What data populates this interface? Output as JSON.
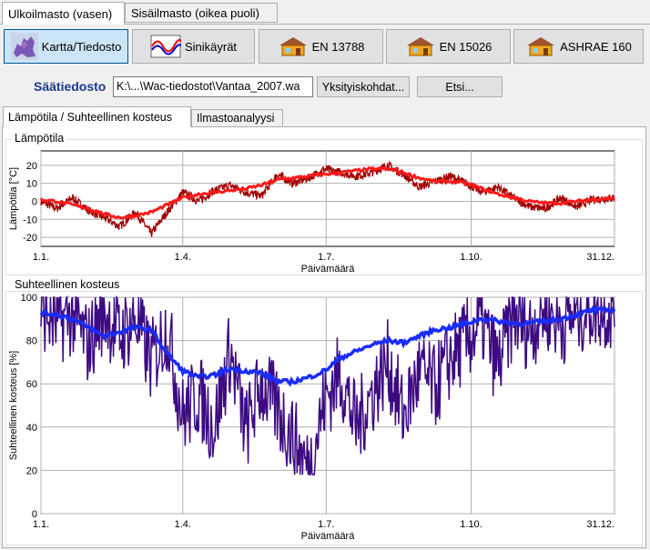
{
  "top_tabs": [
    {
      "label": "Ulkoilmasto (vasen)"
    },
    {
      "label": "Sisäilmasto (oikea puoli)"
    }
  ],
  "toolbar": {
    "map_label": "Kartta/Tiedosto",
    "sine_label": "Sinikäyrät",
    "en13788_label": "EN 13788",
    "en15026_label": "EN 15026",
    "ashrae_label": "ASHRAE 160"
  },
  "weather": {
    "label": "Säätiedosto",
    "path_value": "K:\\...\\Wac-tiedostot\\Vantaa_2007.wa",
    "details_label": "Yksityiskohdat...",
    "search_label": "Etsi..."
  },
  "sub_tabs": [
    {
      "label": "Lämpötila / Suhteellinen kosteus"
    },
    {
      "label": "Ilmastoanalyysi"
    }
  ],
  "colors": {
    "temp_raw": "#a00000",
    "temp_mean": "#ff1a1a",
    "rh_raw": "#3d0a82",
    "rh_mean": "#1a2dff"
  },
  "chart_data": [
    {
      "type": "line",
      "title": "Lämpötila",
      "xlabel": "Päivämäärä",
      "ylabel": "Lämpötila [°C]",
      "xticks": [
        "1.1.",
        "1.4.",
        "1.7.",
        "1.10.",
        "31.12."
      ],
      "xtick_days": [
        0,
        90,
        181,
        273,
        364
      ],
      "xlim": [
        0,
        364
      ],
      "ylim": [
        -25,
        28
      ],
      "yticks": [
        -20,
        -10,
        0,
        10,
        20
      ],
      "grid": true,
      "series": [
        {
          "role": "raw",
          "x": [
            0,
            10,
            20,
            30,
            40,
            50,
            60,
            70,
            80,
            90,
            100,
            110,
            120,
            130,
            140,
            150,
            160,
            170,
            180,
            190,
            200,
            210,
            220,
            230,
            240,
            250,
            260,
            270,
            280,
            290,
            300,
            310,
            320,
            330,
            340,
            350,
            364
          ],
          "values": [
            0,
            -4,
            2,
            -5,
            -9,
            -14,
            -6,
            -18,
            -6,
            5,
            0,
            6,
            9,
            5,
            3,
            15,
            10,
            13,
            18,
            16,
            14,
            16,
            20,
            15,
            8,
            11,
            14,
            10,
            5,
            8,
            2,
            -3,
            -4,
            2,
            -3,
            1,
            2
          ]
        },
        {
          "role": "mean",
          "x": [
            0,
            10,
            20,
            30,
            40,
            50,
            60,
            70,
            80,
            90,
            100,
            110,
            120,
            130,
            140,
            150,
            160,
            170,
            180,
            190,
            200,
            210,
            220,
            230,
            240,
            250,
            260,
            270,
            280,
            290,
            300,
            310,
            320,
            330,
            340,
            350,
            364
          ],
          "values": [
            1,
            0,
            -2,
            -4,
            -7,
            -9,
            -8,
            -6,
            -2,
            2,
            4,
            5,
            6,
            7,
            9,
            12,
            13,
            14,
            15,
            16,
            17,
            18,
            18,
            16,
            13,
            11,
            11,
            10,
            7,
            4,
            2,
            0,
            -1,
            -1,
            0,
            1,
            2
          ]
        }
      ]
    },
    {
      "type": "line",
      "title": "Suhteellinen kosteus",
      "xlabel": "Päivämäärä",
      "ylabel": "Suhteellinen kosteus [%]",
      "xticks": [
        "1.1.",
        "1.4.",
        "1.7.",
        "1.10.",
        "31.12."
      ],
      "xtick_days": [
        0,
        90,
        181,
        273,
        364
      ],
      "xlim": [
        0,
        364
      ],
      "ylim": [
        0,
        100
      ],
      "yticks": [
        0,
        20,
        40,
        60,
        80,
        100
      ],
      "grid": true,
      "series": [
        {
          "role": "raw",
          "x": [
            0,
            10,
            20,
            30,
            40,
            50,
            60,
            70,
            80,
            90,
            100,
            110,
            120,
            130,
            140,
            150,
            160,
            170,
            180,
            190,
            200,
            210,
            220,
            230,
            240,
            250,
            260,
            270,
            280,
            290,
            300,
            310,
            320,
            330,
            340,
            350,
            364
          ],
          "values": [
            95,
            88,
            92,
            78,
            94,
            82,
            90,
            70,
            86,
            45,
            55,
            40,
            75,
            38,
            60,
            48,
            35,
            20,
            52,
            65,
            40,
            55,
            70,
            45,
            65,
            58,
            72,
            80,
            88,
            68,
            92,
            85,
            95,
            88,
            92,
            96,
            94
          ]
        },
        {
          "role": "mean",
          "x": [
            0,
            10,
            20,
            30,
            40,
            50,
            60,
            70,
            80,
            90,
            100,
            110,
            120,
            130,
            140,
            150,
            160,
            170,
            180,
            190,
            200,
            210,
            220,
            230,
            240,
            250,
            260,
            270,
            280,
            290,
            300,
            310,
            320,
            330,
            340,
            350,
            364
          ],
          "values": [
            93,
            92,
            90,
            86,
            82,
            84,
            86,
            85,
            74,
            66,
            63,
            64,
            67,
            66,
            65,
            61,
            61,
            63,
            66,
            72,
            75,
            78,
            80,
            79,
            82,
            85,
            86,
            88,
            90,
            89,
            88,
            88,
            89,
            90,
            92,
            94,
            94
          ]
        }
      ]
    }
  ]
}
